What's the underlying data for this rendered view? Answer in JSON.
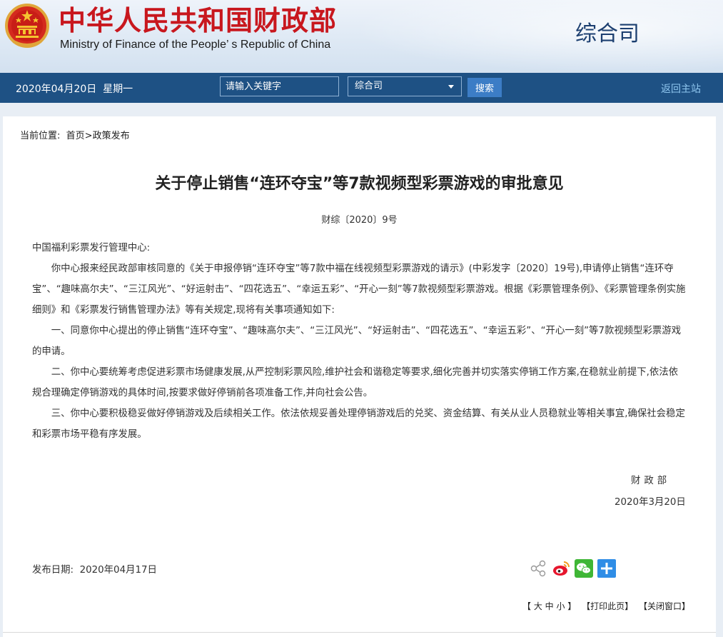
{
  "header": {
    "site_title": "中华人民共和国财政部",
    "site_subtitle": "Ministry of Finance of the People’ s Republic of China",
    "department": "综合司",
    "colors": {
      "title_red": "#c8171e",
      "nav_blue": "#1e5184"
    }
  },
  "navbar": {
    "date": "2020年04月20日",
    "weekday": "星期一",
    "search_placeholder": "请输入关键字",
    "select_value": "综合司",
    "search_button": "搜索",
    "home_link": "返回主站"
  },
  "breadcrumb": {
    "prefix": "当前位置:",
    "home": "首页",
    "separator": ">",
    "current": "政策发布"
  },
  "article": {
    "title": "关于停止销售“连环夺宝”等7款视频型彩票游戏的审批意见",
    "doc_number": "财综〔2020〕9号",
    "salutation": "中国福利彩票发行管理中心:",
    "paragraphs": [
      "你中心报来经民政部审核同意的《关于申报停销“连环夺宝”等7款中福在线视频型彩票游戏的请示》(中彩发字〔2020〕19号),申请停止销售“连环夺宝”、“趣味高尔夫”、“三江风光”、“好运射击”、“四花选五”、“幸运五彩”、“开心一刻”等7款视频型彩票游戏。根据《彩票管理条例》、《彩票管理条例实施细则》和《彩票发行销售管理办法》等有关规定,现将有关事项通知如下:",
      "一、同意你中心提出的停止销售“连环夺宝”、“趣味高尔夫”、“三江风光”、“好运射击”、“四花选五”、“幸运五彩”、“开心一刻”等7款视频型彩票游戏的申请。",
      "二、你中心要统筹考虑促进彩票市场健康发展,从严控制彩票风险,维护社会和谐稳定等要求,细化完善并切实落实停销工作方案,在稳就业前提下,依法依规合理确定停销游戏的具体时间,按要求做好停销前各项准备工作,并向社会公告。",
      "三、你中心要积极稳妥做好停销游戏及后续相关工作。依法依规妥善处理停销游戏后的兑奖、资金结算、有关从业人员稳就业等相关事宜,确保社会稳定和彩票市场平稳有序发展。"
    ],
    "signature": "财政部",
    "sign_date": "2020年3月20日",
    "publish_date_label": "发布日期:",
    "publish_date": "2020年04月17日"
  },
  "share": {
    "icons": [
      "share-icon",
      "weibo-icon",
      "wechat-icon",
      "more-plus-icon"
    ]
  },
  "tools": {
    "font_size": "【 大 中 小 】",
    "print": "【打印此页】",
    "close": "【关闭窗口】"
  }
}
